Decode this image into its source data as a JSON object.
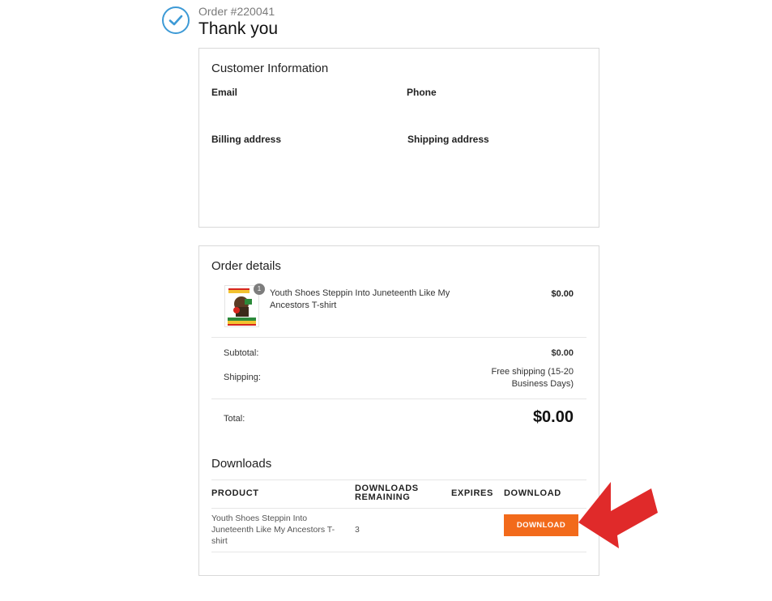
{
  "header": {
    "order_number": "Order #220041",
    "title": "Thank you"
  },
  "customer": {
    "title": "Customer Information",
    "email_label": "Email",
    "phone_label": "Phone",
    "billing_label": "Billing address",
    "shipping_label": "Shipping address"
  },
  "order": {
    "title": "Order details",
    "item": {
      "quantity": "1",
      "name": "Youth Shoes Steppin Into Juneteenth Like My Ancestors T-shirt",
      "price": "$0.00"
    },
    "subtotal_label": "Subtotal:",
    "subtotal_value": "$0.00",
    "shipping_label": "Shipping:",
    "shipping_value": "Free shipping (15-20 Business Days)",
    "total_label": "Total:",
    "total_value": "$0.00"
  },
  "downloads": {
    "title": "Downloads",
    "columns": [
      "PRODUCT",
      "DOWNLOADS REMAINING",
      "EXPIRES",
      "DOWNLOAD"
    ],
    "rows": [
      {
        "product": "Youth Shoes Steppin Into Juneteenth Like My Ancestors T-shirt",
        "remaining": "3",
        "expires": "",
        "button_label": "DOWNLOAD"
      }
    ]
  },
  "colors": {
    "accent_blue": "#3d9ad6",
    "button_orange": "#f26a1b",
    "arrow_red": "#e02a2a"
  }
}
